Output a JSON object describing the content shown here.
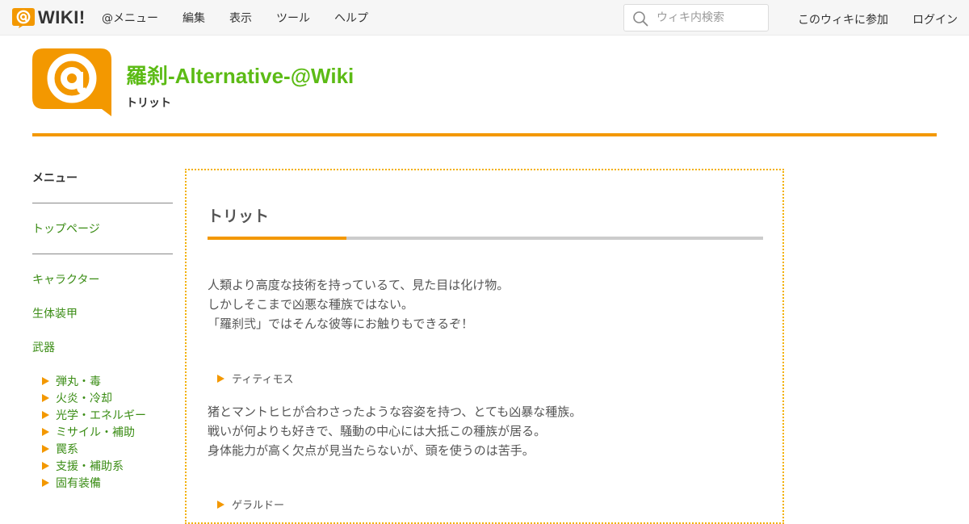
{
  "topbar": {
    "brand_text": "WIKI!",
    "nav": [
      "@メニュー",
      "編集",
      "表示",
      "ツール",
      "ヘルプ"
    ],
    "search_placeholder": "ウィキ内検索",
    "join_label": "このウィキに参加",
    "login_label": "ログイン"
  },
  "header": {
    "site_title": "羅刹-Alternative-@Wiki",
    "page_subtitle": "トリット"
  },
  "sidebar": {
    "heading": "メニュー",
    "top_link": "トップページ",
    "links": [
      "キャラクター",
      "生体装甲",
      "武器"
    ],
    "sub_items": [
      "弾丸・毒",
      "火炎・冷却",
      "光学・エネルギー",
      "ミサイル・補助",
      "罠系",
      "支援・補助系",
      "固有装備"
    ]
  },
  "main": {
    "title": "トリット",
    "intro_lines": [
      "人類より高度な技術を持っているて、見た目は化け物。",
      "しかしそこまで凶悪な種族ではない。",
      "「羅刹弐」ではそんな彼等にお触りもできるぞ！"
    ],
    "section1_label": "ティティモス",
    "section1_lines": [
      "猪とマントヒヒが合わさったような容姿を持つ、とても凶暴な種族。",
      "戦いが何よりも好きで、騒動の中心には大抵この種族が居る。",
      "身体能力が高く欠点が見当たらないが、頭を使うのは苦手。"
    ],
    "section2_label": "ゲラルドー"
  },
  "colors": {
    "accent": "#f39800",
    "title_green": "#5cbb15",
    "link_green": "#3a8c14"
  }
}
